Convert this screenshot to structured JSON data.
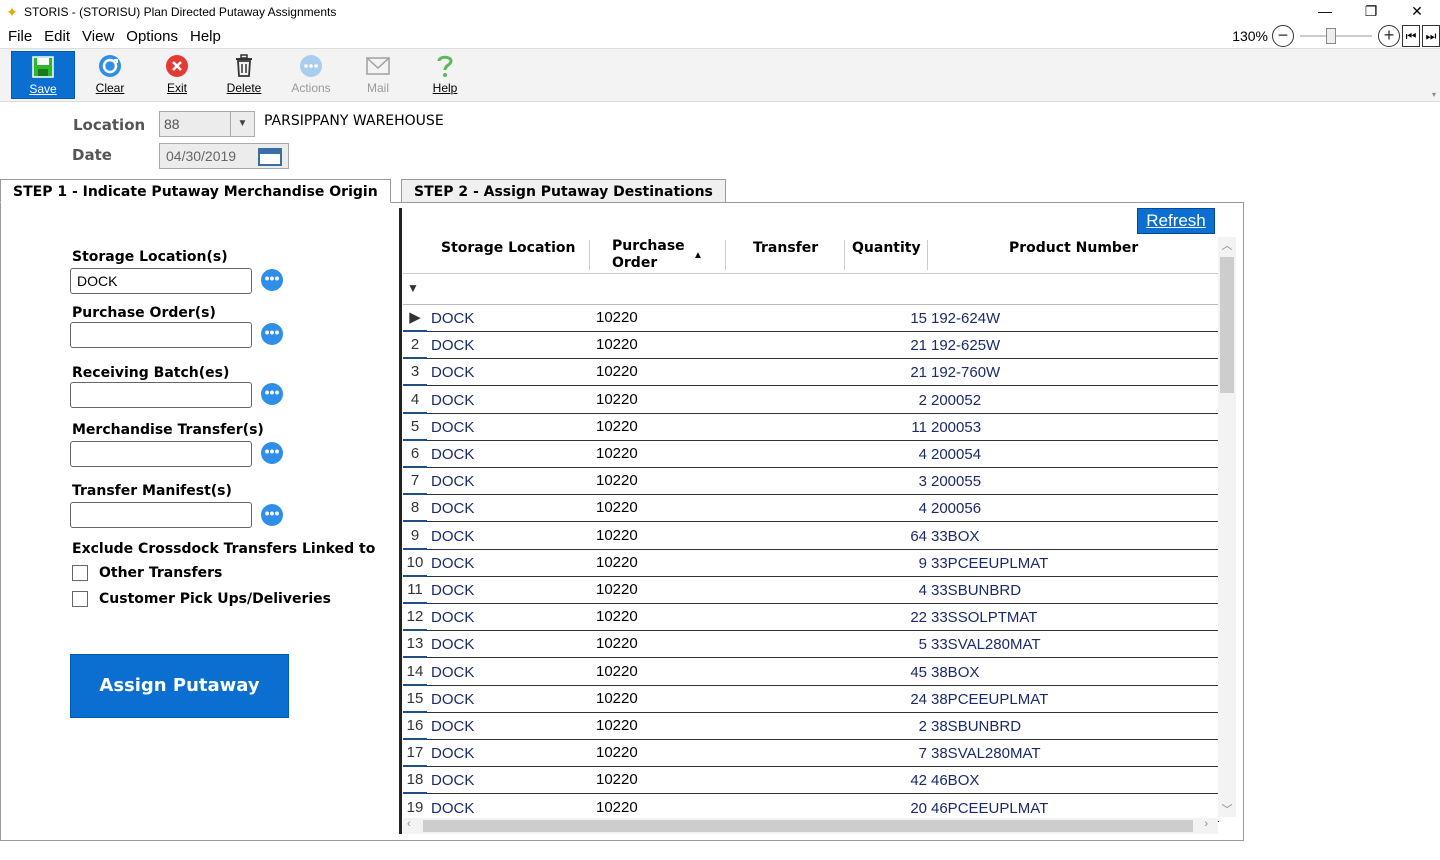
{
  "window": {
    "title": "STORIS - (STORISU) Plan Directed Putaway Assignments",
    "minimize": "—",
    "restore": "❐",
    "close": "✕"
  },
  "menu": {
    "items": [
      {
        "label": "File"
      },
      {
        "label": "Edit"
      },
      {
        "label": "View"
      },
      {
        "label": "Options"
      },
      {
        "label": "Help"
      }
    ]
  },
  "zoom": {
    "label": "130%",
    "minus": "−",
    "plus": "+",
    "first": "⏮",
    "last": "⏭",
    "level_percent": 130
  },
  "toolbar": {
    "save": "Save",
    "clear": "Clear",
    "exit": "Exit",
    "delete": "Delete",
    "actions": "Actions",
    "mail": "Mail",
    "help": "Help"
  },
  "header": {
    "location_label": "Location",
    "location_value": "88",
    "location_name": "PARSIPPANY WAREHOUSE",
    "date_label": "Date",
    "date_value": "04/30/2019"
  },
  "tabs": {
    "step1": "STEP 1 - Indicate Putaway Merchandise Origin",
    "step2": "STEP 2 - Assign Putaway Destinations"
  },
  "criteria": {
    "storage_label": "Storage Location(s)",
    "storage_value": "DOCK",
    "po_label": "Purchase Order(s)",
    "po_value": "",
    "batch_label": "Receiving Batch(es)",
    "batch_value": "",
    "transfer_label": "Merchandise Transfer(s)",
    "transfer_value": "",
    "manifest_label": "Transfer Manifest(s)",
    "manifest_value": "",
    "exclude_label": "Exclude Crossdock Transfers Linked to",
    "other_transfers": "Other Transfers",
    "customer_pickups": "Customer Pick Ups/Deliveries",
    "assign_button": "Assign Putaway",
    "dots": "•••"
  },
  "grid": {
    "refresh": "Refresh",
    "columns": {
      "storage_location": "Storage Location",
      "purchase_order_1": "Purchase",
      "purchase_order_2": "Order",
      "transfer": "Transfer",
      "quantity": "Quantity",
      "product_number": "Product Number"
    },
    "rows": [
      {
        "num": "▶",
        "loc": "DOCK",
        "po": "10220",
        "qty": "15",
        "prod": "192-624W"
      },
      {
        "num": "2",
        "loc": "DOCK",
        "po": "10220",
        "qty": "21",
        "prod": "192-625W"
      },
      {
        "num": "3",
        "loc": "DOCK",
        "po": "10220",
        "qty": "21",
        "prod": "192-760W"
      },
      {
        "num": "4",
        "loc": "DOCK",
        "po": "10220",
        "qty": "2",
        "prod": "200052"
      },
      {
        "num": "5",
        "loc": "DOCK",
        "po": "10220",
        "qty": "11",
        "prod": "200053"
      },
      {
        "num": "6",
        "loc": "DOCK",
        "po": "10220",
        "qty": "4",
        "prod": "200054"
      },
      {
        "num": "7",
        "loc": "DOCK",
        "po": "10220",
        "qty": "3",
        "prod": "200055"
      },
      {
        "num": "8",
        "loc": "DOCK",
        "po": "10220",
        "qty": "4",
        "prod": "200056"
      },
      {
        "num": "9",
        "loc": "DOCK",
        "po": "10220",
        "qty": "64",
        "prod": "33BOX"
      },
      {
        "num": "10",
        "loc": "DOCK",
        "po": "10220",
        "qty": "9",
        "prod": "33PCEEUPLMAT"
      },
      {
        "num": "11",
        "loc": "DOCK",
        "po": "10220",
        "qty": "4",
        "prod": "33SBUNBRD"
      },
      {
        "num": "12",
        "loc": "DOCK",
        "po": "10220",
        "qty": "22",
        "prod": "33SSOLPTMAT"
      },
      {
        "num": "13",
        "loc": "DOCK",
        "po": "10220",
        "qty": "5",
        "prod": "33SVAL280MAT"
      },
      {
        "num": "14",
        "loc": "DOCK",
        "po": "10220",
        "qty": "45",
        "prod": "38BOX"
      },
      {
        "num": "15",
        "loc": "DOCK",
        "po": "10220",
        "qty": "24",
        "prod": "38PCEEUPLMAT"
      },
      {
        "num": "16",
        "loc": "DOCK",
        "po": "10220",
        "qty": "2",
        "prod": "38SBUNBRD"
      },
      {
        "num": "17",
        "loc": "DOCK",
        "po": "10220",
        "qty": "7",
        "prod": "38SVAL280MAT"
      },
      {
        "num": "18",
        "loc": "DOCK",
        "po": "10220",
        "qty": "42",
        "prod": "46BOX"
      },
      {
        "num": "19",
        "loc": "DOCK",
        "po": "10220",
        "qty": "20",
        "prod": "46PCEEUPLMAT"
      }
    ]
  },
  "colors": {
    "accent": "#0a6fd0",
    "row_text": "#1a2a6a"
  }
}
